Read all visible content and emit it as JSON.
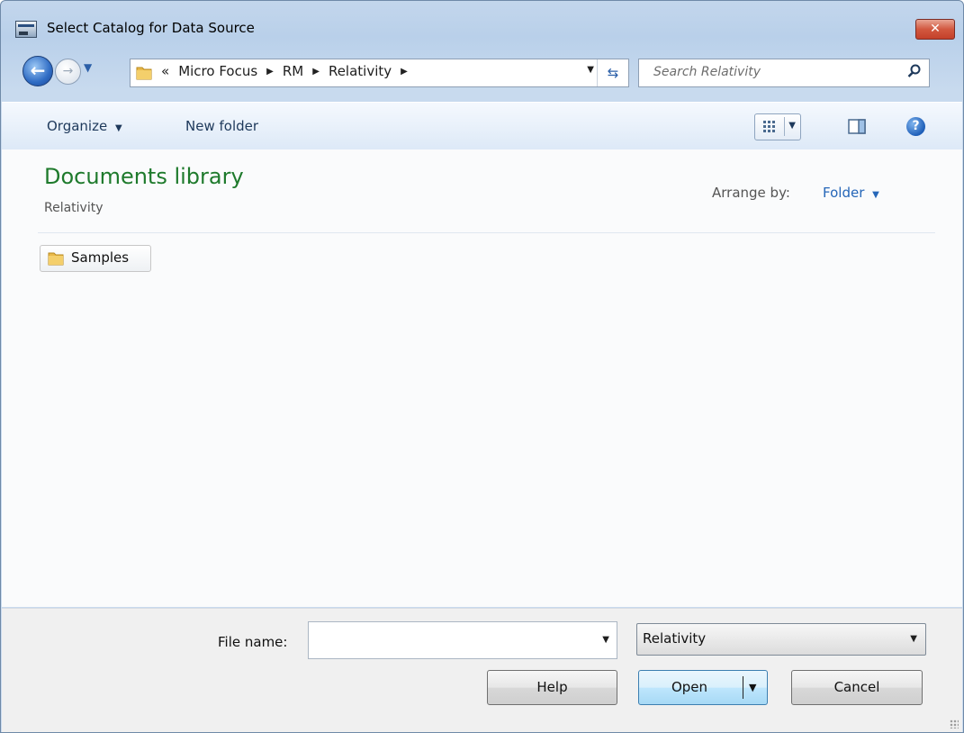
{
  "window": {
    "title": "Select Catalog for Data Source"
  },
  "nav": {
    "breadcrumb": [
      "Micro Focus",
      "RM",
      "Relativity"
    ],
    "overflow_glyph": "«",
    "search_placeholder": "Search Relativity"
  },
  "toolbar": {
    "organize_label": "Organize",
    "new_folder_label": "New folder"
  },
  "library": {
    "title": "Documents library",
    "subtitle": "Relativity",
    "arrange_label": "Arrange by:",
    "arrange_value": "Folder"
  },
  "items": [
    {
      "label": "Samples",
      "icon": "folder-icon"
    }
  ],
  "footer": {
    "file_name_label": "File name:",
    "file_name_value": "",
    "file_type_value": "Relativity",
    "help_label": "Help",
    "open_label": "Open",
    "cancel_label": "Cancel"
  },
  "colors": {
    "library_title": "#1e7a2c",
    "link": "#2566b8",
    "close_button": "#d2583f"
  }
}
